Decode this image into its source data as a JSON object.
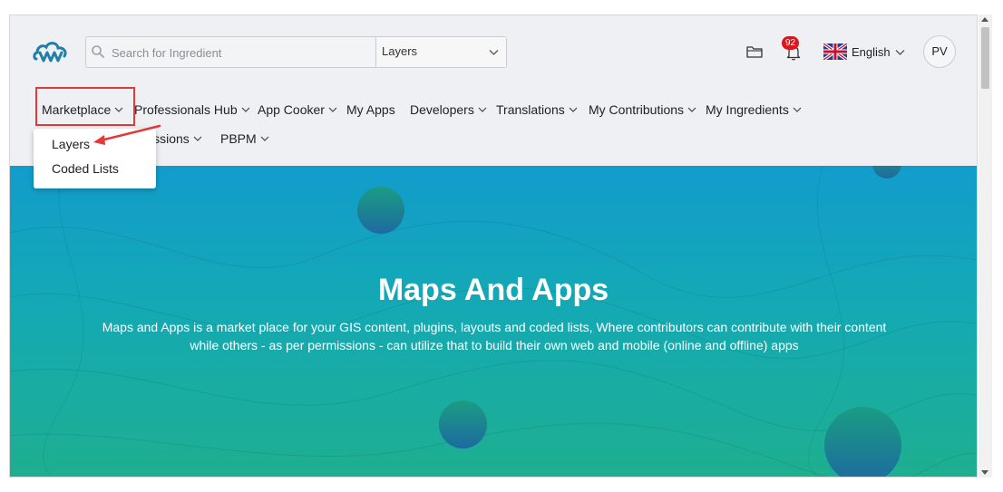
{
  "header": {
    "search": {
      "placeholder": "Search for Ingredient",
      "value": ""
    },
    "category_select": {
      "selected": "Layers"
    },
    "notifications": {
      "count": "92"
    },
    "language": {
      "label": "English"
    },
    "user": {
      "initials": "PV"
    }
  },
  "nav": {
    "items": [
      {
        "label": "Marketplace"
      },
      {
        "label": "Professionals Hub"
      },
      {
        "label": "App Cooker"
      },
      {
        "label": "My Apps"
      },
      {
        "label": "Developers"
      },
      {
        "label": "Translations"
      },
      {
        "label": "My Contributions"
      },
      {
        "label": "My Ingredients"
      },
      {
        "label": "issions"
      },
      {
        "label": "PBPM"
      }
    ]
  },
  "marketplace_menu": {
    "items": [
      {
        "label": "Layers"
      },
      {
        "label": "Coded Lists"
      }
    ]
  },
  "hero": {
    "title": "Maps And Apps",
    "description": "Maps and Apps is a market place for your GIS content, plugins, layouts and coded lists, Where contributors can contribute with their content while others - as per permissions - can utilize that to build their own web and mobile (online and offline) apps"
  },
  "colors": {
    "brand": "#1f7fa8",
    "highlight": "#e03a3a",
    "badge": "#d6181f",
    "hero_top": "#129ccc",
    "hero_bottom": "#1eaf8f"
  },
  "icons": [
    "logo-icon",
    "search-icon",
    "chevron-down-icon",
    "folder-icon",
    "bell-icon",
    "uk-flag-icon",
    "annotation-arrow-icon"
  ]
}
